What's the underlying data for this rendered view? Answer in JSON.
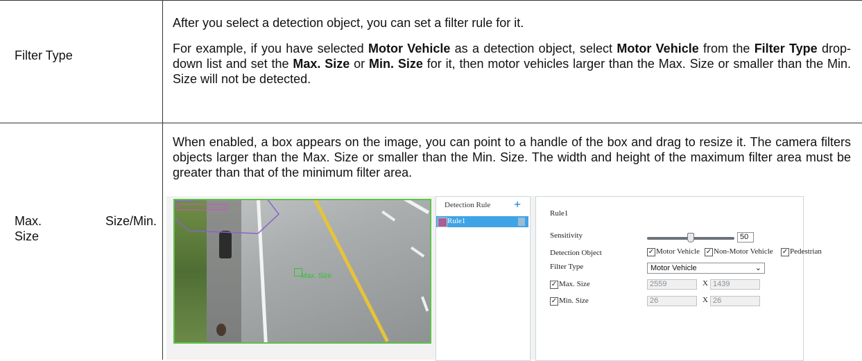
{
  "rows": [
    {
      "label": "Filter Type",
      "p1": "After you select a detection object, you can set a filter rule for it.",
      "p2_segments": [
        "For example, if you have selected ",
        "Motor Vehicle",
        " as a detection object, select ",
        "Motor Vehicle",
        " from the ",
        "Filter Type",
        " drop-down list and set the ",
        "Max. Size",
        " or ",
        "Min. Size",
        " for it, then motor vehicles larger than the Max. Size or smaller than the Min. Size will not be detected."
      ]
    },
    {
      "label": "Max.        Size/Min. Size",
      "label_line1a": "Max.",
      "label_line1b": "Size/Min.",
      "label_line2": "Size",
      "p1": "When enabled, a box appears on the image, you can point to a handle of the box and drag to resize it. The camera filters objects larger than the Max. Size or smaller than the Min. Size. The width and height of the maximum filter area must be greater than that of the minimum filter area."
    }
  ],
  "screenshot": {
    "camera_overlay_text": "Max. Size",
    "rule_panel": {
      "header": "Detection Rule",
      "add_icon": "plus-icon",
      "rule_name": "Rule1",
      "delete_icon": "trash-icon"
    },
    "config": {
      "title": "Rule1",
      "sensitivity_label": "Sensitivity",
      "sensitivity_value": "50",
      "sensitivity_level": 0.5,
      "detection_object_label": "Detection Object",
      "detection_objects": [
        {
          "label": "Motor Vehicle",
          "checked": true
        },
        {
          "label": "Non-Motor Vehicle",
          "checked": true
        },
        {
          "label": "Pedestrian",
          "checked": true
        }
      ],
      "filter_type_label": "Filter Type",
      "filter_type_value": "Motor Vehicle",
      "max_size_label": "Max. Size",
      "max_size_checked": true,
      "max_w": "2559",
      "max_h": "1439",
      "min_size_label": "Min. Size",
      "min_size_checked": true,
      "min_w": "26",
      "min_h": "26",
      "x_sep": "X"
    },
    "colors": {
      "selected_rule": "#3ea4e6",
      "frame": "#5fc14a",
      "lane_yellow": "#e6c33a",
      "zone_outline": "#8a62c9"
    }
  }
}
